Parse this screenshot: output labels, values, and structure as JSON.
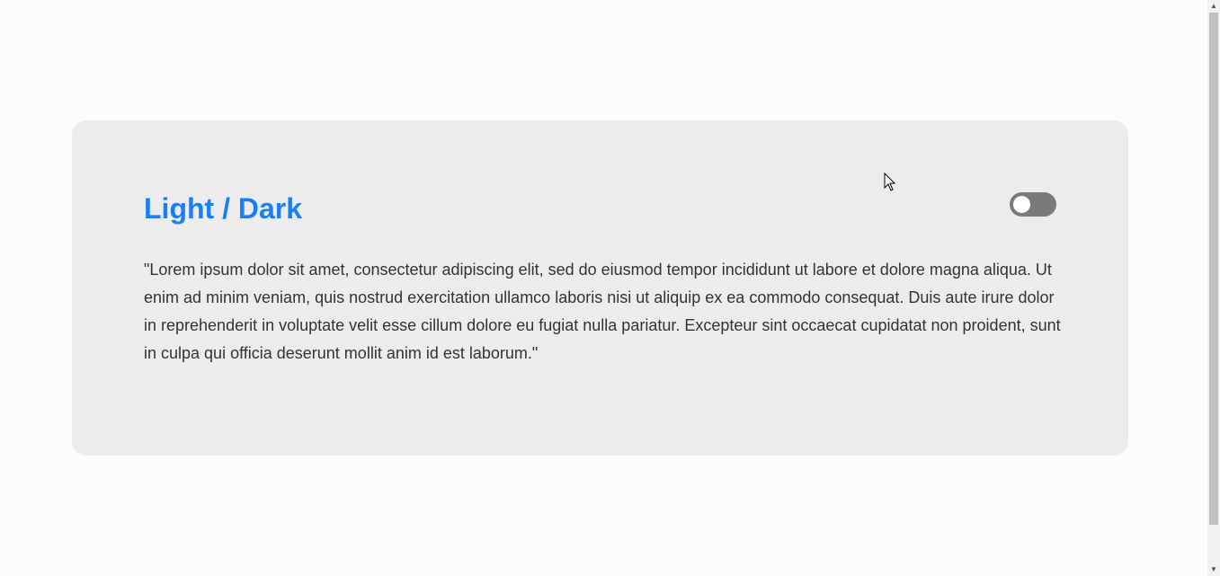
{
  "card": {
    "title": "Light / Dark",
    "toggle_state": "off",
    "body": "\"Lorem ipsum dolor sit amet, consectetur adipiscing elit, sed do eiusmod tempor incididunt ut labore et dolore magna aliqua. Ut enim ad minim veniam, quis nostrud exercitation ullamco laboris nisi ut aliquip ex ea commodo consequat. Duis aute irure dolor in reprehenderit in voluptate velit esse cillum dolore eu fugiat nulla pariatur. Excepteur sint occaecat cupidatat non proident, sunt in culpa qui officia deserunt mollit anim id est laborum.\""
  },
  "colors": {
    "page_background": "#fcfcfc",
    "card_background": "#ececec",
    "title": "#1a7ff5",
    "body_text": "#333333",
    "toggle_track": "#7a7a7a",
    "toggle_knob": "#ffffff"
  },
  "scrollbar": {
    "up_icon": "triangle-up",
    "down_icon": "triangle-down"
  }
}
